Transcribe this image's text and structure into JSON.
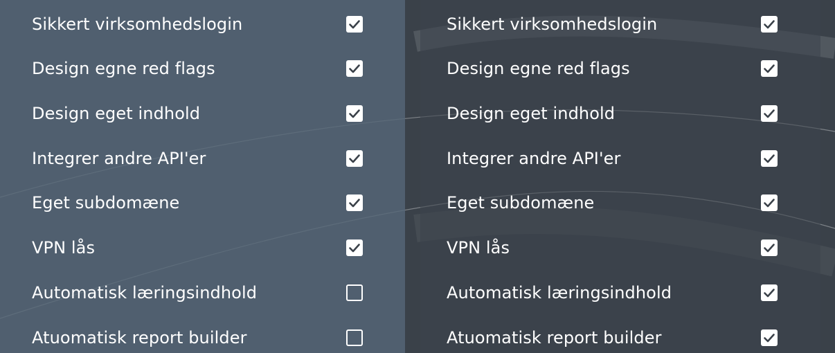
{
  "colors": {
    "background": "#3a4149",
    "left_column": "#566678",
    "text": "#ffffff",
    "check_mark": "#3a4149"
  },
  "left_column": {
    "rows": [
      {
        "label": "Sikkert virksomhedslogin",
        "checked": true
      },
      {
        "label": "Design egne red flags",
        "checked": true
      },
      {
        "label": "Design eget indhold",
        "checked": true
      },
      {
        "label": "Integrer andre API'er",
        "checked": true
      },
      {
        "label": "Eget subdomæne",
        "checked": true
      },
      {
        "label": "VPN lås",
        "checked": true
      },
      {
        "label": "Automatisk læringsindhold",
        "checked": false
      },
      {
        "label": "Atuomatisk report builder",
        "checked": false
      }
    ]
  },
  "right_column": {
    "rows": [
      {
        "label": "Sikkert virksomhedslogin",
        "checked": true
      },
      {
        "label": "Design egne red flags",
        "checked": true
      },
      {
        "label": "Design eget indhold",
        "checked": true
      },
      {
        "label": "Integrer andre API'er",
        "checked": true
      },
      {
        "label": "Eget subdomæne",
        "checked": true
      },
      {
        "label": "VPN lås",
        "checked": true
      },
      {
        "label": "Automatisk læringsindhold",
        "checked": true
      },
      {
        "label": "Atuomatisk report builder",
        "checked": true
      }
    ]
  }
}
